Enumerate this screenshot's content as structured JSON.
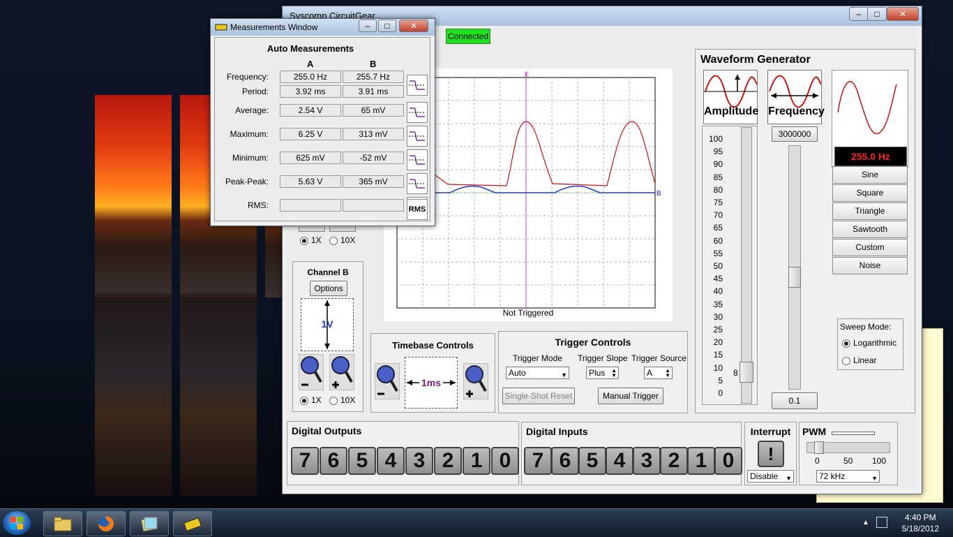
{
  "app": {
    "title": "Syscomp CircuitGear",
    "connection_status": "Connected"
  },
  "measurements": {
    "window_title": "Measurements Window",
    "heading": "Auto Measurements",
    "col_a": "A",
    "col_b": "B",
    "rows": [
      {
        "label": "Frequency:",
        "a": "255.0 Hz",
        "b": "255.7 Hz"
      },
      {
        "label": "Period:",
        "a": "3.92 ms",
        "b": "3.91 ms"
      },
      {
        "label": "Average:",
        "a": "2.54 V",
        "b": "65 mV"
      },
      {
        "label": "Maximum:",
        "a": "6.25 V",
        "b": "313 mV"
      },
      {
        "label": "Minimum:",
        "a": "625 mV",
        "b": "-52 mV"
      },
      {
        "label": "Peak-Peak:",
        "a": "5.63 V",
        "b": "365 mV"
      },
      {
        "label": "RMS:",
        "a": "",
        "b": ""
      }
    ],
    "rms_icon_text": "RMS"
  },
  "scope": {
    "status": "Not Triggered",
    "marker_b": "B",
    "marker_x": "X"
  },
  "channel_a": {
    "probe_1x": "1X",
    "probe_10x": "10X",
    "probe": "1X"
  },
  "channel_b": {
    "title": "Channel B",
    "options_label": "Options",
    "volts_div": "1V",
    "probe_1x": "1X",
    "probe_10x": "10X",
    "probe": "1X"
  },
  "timebase": {
    "title": "Timebase Controls",
    "value": "1ms"
  },
  "trigger": {
    "title": "Trigger Controls",
    "mode_label": "Trigger Mode",
    "mode_value": "Auto",
    "slope_label": "Trigger Slope",
    "slope_value": "Plus",
    "source_label": "Trigger Source",
    "source_value": "A",
    "single_shot_label": "Single-Shot Reset",
    "manual_label": "Manual Trigger"
  },
  "waveform": {
    "title": "Waveform Generator",
    "amplitude_label": "Amplitude",
    "frequency_label": "Frequency",
    "frequency_input": "3000000",
    "frequency_min": "0.1",
    "freq_display": "255.0 Hz",
    "amp_slider_value": "8",
    "amp_scale": [
      "100",
      "95",
      "90",
      "85",
      "80",
      "75",
      "70",
      "65",
      "60",
      "55",
      "50",
      "45",
      "40",
      "35",
      "30",
      "25",
      "20",
      "15",
      "10",
      "5",
      "0"
    ],
    "buttons": [
      "Sine",
      "Square",
      "Triangle",
      "Sawtooth",
      "Custom",
      "Noise"
    ],
    "sweep_label": "Sweep Mode:",
    "sweep_options": [
      "Logarithmic",
      "Linear"
    ],
    "sweep_selected": "Logarithmic"
  },
  "digital_outputs": {
    "title": "Digital Outputs",
    "bits": [
      "7",
      "6",
      "5",
      "4",
      "3",
      "2",
      "1",
      "0"
    ]
  },
  "digital_inputs": {
    "title": "Digital Inputs",
    "bits": [
      "7",
      "6",
      "5",
      "4",
      "3",
      "2",
      "1",
      "0"
    ]
  },
  "interrupt": {
    "title": "Interrupt",
    "icon_text": "!",
    "select_value": "Disable"
  },
  "pwm": {
    "title": "PWM",
    "scale": [
      "0",
      "50",
      "100"
    ],
    "freq_value": "72 kHz",
    "duty_percent": 10
  },
  "taskbar": {
    "time": "4:40 PM",
    "date": "5/18/2012"
  }
}
